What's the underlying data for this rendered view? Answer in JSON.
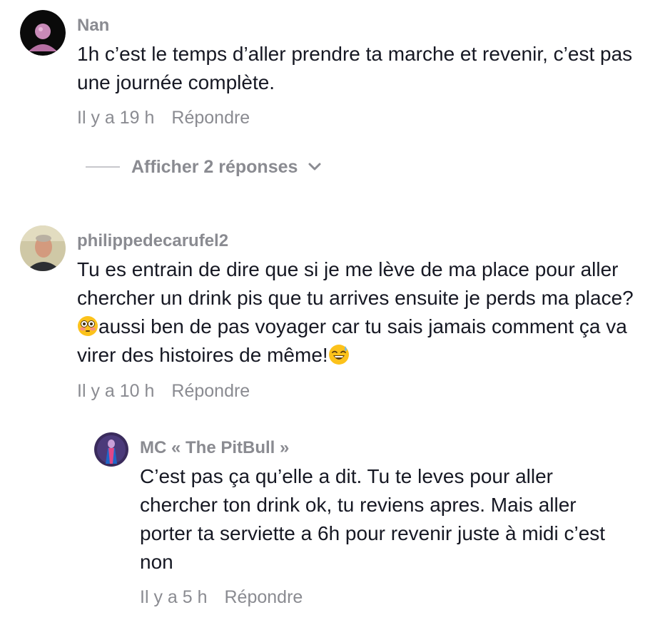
{
  "comments": [
    {
      "username": "Nan",
      "text": "1h c’est le temps d’aller prendre ta marche et revenir, c’est pas une journée complète.",
      "time": "Il y a 19 h",
      "reply_label": "Répondre",
      "view_replies_label": "Afficher 2 réponses"
    },
    {
      "username": "philippedecarufel2",
      "text_part1": "Tu es entrain de dire que si je me lève de ma place pour aller chercher un drink pis que tu arrives ensuite je perds ma place?",
      "text_part2": "aussi ben de pas voyager car tu sais jamais comment ça va virer des histoires de même!",
      "emoji1": "flushed-face-emoji",
      "emoji2": "grinning-sweat-emoji",
      "time": "Il y a 10 h",
      "reply_label": "Répondre",
      "reply": {
        "username": "MC « The PitBull »",
        "text": "C’est pas ça qu’elle a dit. Tu te leves pour aller chercher ton drink ok, tu reviens apres. Mais aller porter ta serviette a 6h pour revenir juste à midi c’est non",
        "time": "Il y a 5 h",
        "reply_label": "Répondre"
      }
    }
  ],
  "icons": {
    "chevron": "chevron-down-icon"
  },
  "colors": {
    "text": "#161823",
    "muted": "#8a8b91"
  }
}
